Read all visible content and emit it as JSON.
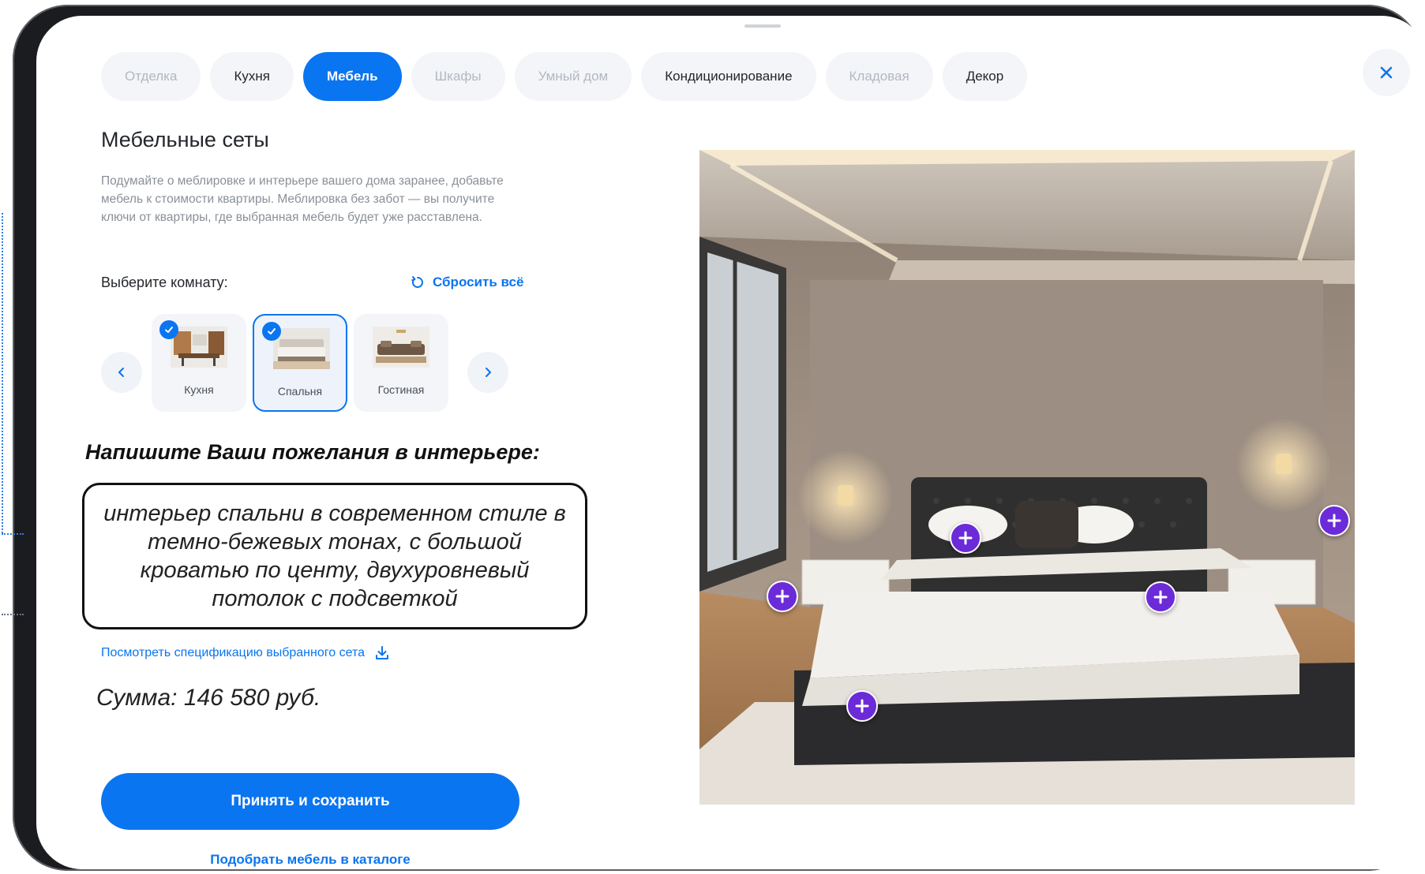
{
  "tabs": [
    {
      "label": "Отделка",
      "state": "muted"
    },
    {
      "label": "Кухня",
      "state": "normal"
    },
    {
      "label": "Мебель",
      "state": "active"
    },
    {
      "label": "Шкафы",
      "state": "muted"
    },
    {
      "label": "Умный дом",
      "state": "muted"
    },
    {
      "label": "Кондиционирование",
      "state": "normal"
    },
    {
      "label": "Кладовая",
      "state": "muted"
    },
    {
      "label": "Декор",
      "state": "normal"
    }
  ],
  "section": {
    "title": "Мебельные сеты",
    "description": "Подумайте о меблировке и интерьере вашего дома заранее, добавьте мебель к стоимости квартиры. Меблировка без забот — вы получите ключи от квартиры, где выбранная мебель будет уже расставлена.",
    "choose_room_label": "Выберите комнату:",
    "reset_label": "Сбросить всё"
  },
  "rooms": [
    {
      "label": "Кухня",
      "checked": true,
      "selected": false
    },
    {
      "label": "Спальня",
      "checked": true,
      "selected": true
    },
    {
      "label": "Гостиная",
      "checked": false,
      "selected": false
    }
  ],
  "wishes": {
    "title": "Напишите Ваши пожелания в интерьере:",
    "text": "интерьер спальни в современном стиле в темно-бежевых тонах, с большой кроватью по центу, двухуровневый потолок с подсветкой"
  },
  "spec_link": "Посмотреть спецификацию выбранного сета",
  "sum": "Сумма: 146 580 руб.",
  "buttons": {
    "accept": "Принять и сохранить",
    "catalog": "Подобрать мебель в каталоге"
  },
  "icons": {
    "close": "close-icon",
    "reset": "refresh-icon",
    "prev": "chevron-left-icon",
    "next": "chevron-right-icon",
    "download": "download-icon",
    "hotspot": "plus-icon",
    "check": "check-icon"
  },
  "colors": {
    "accent": "#0a75f0",
    "hotspot": "#6c2bd9",
    "muted_text": "#b3b8c0"
  }
}
